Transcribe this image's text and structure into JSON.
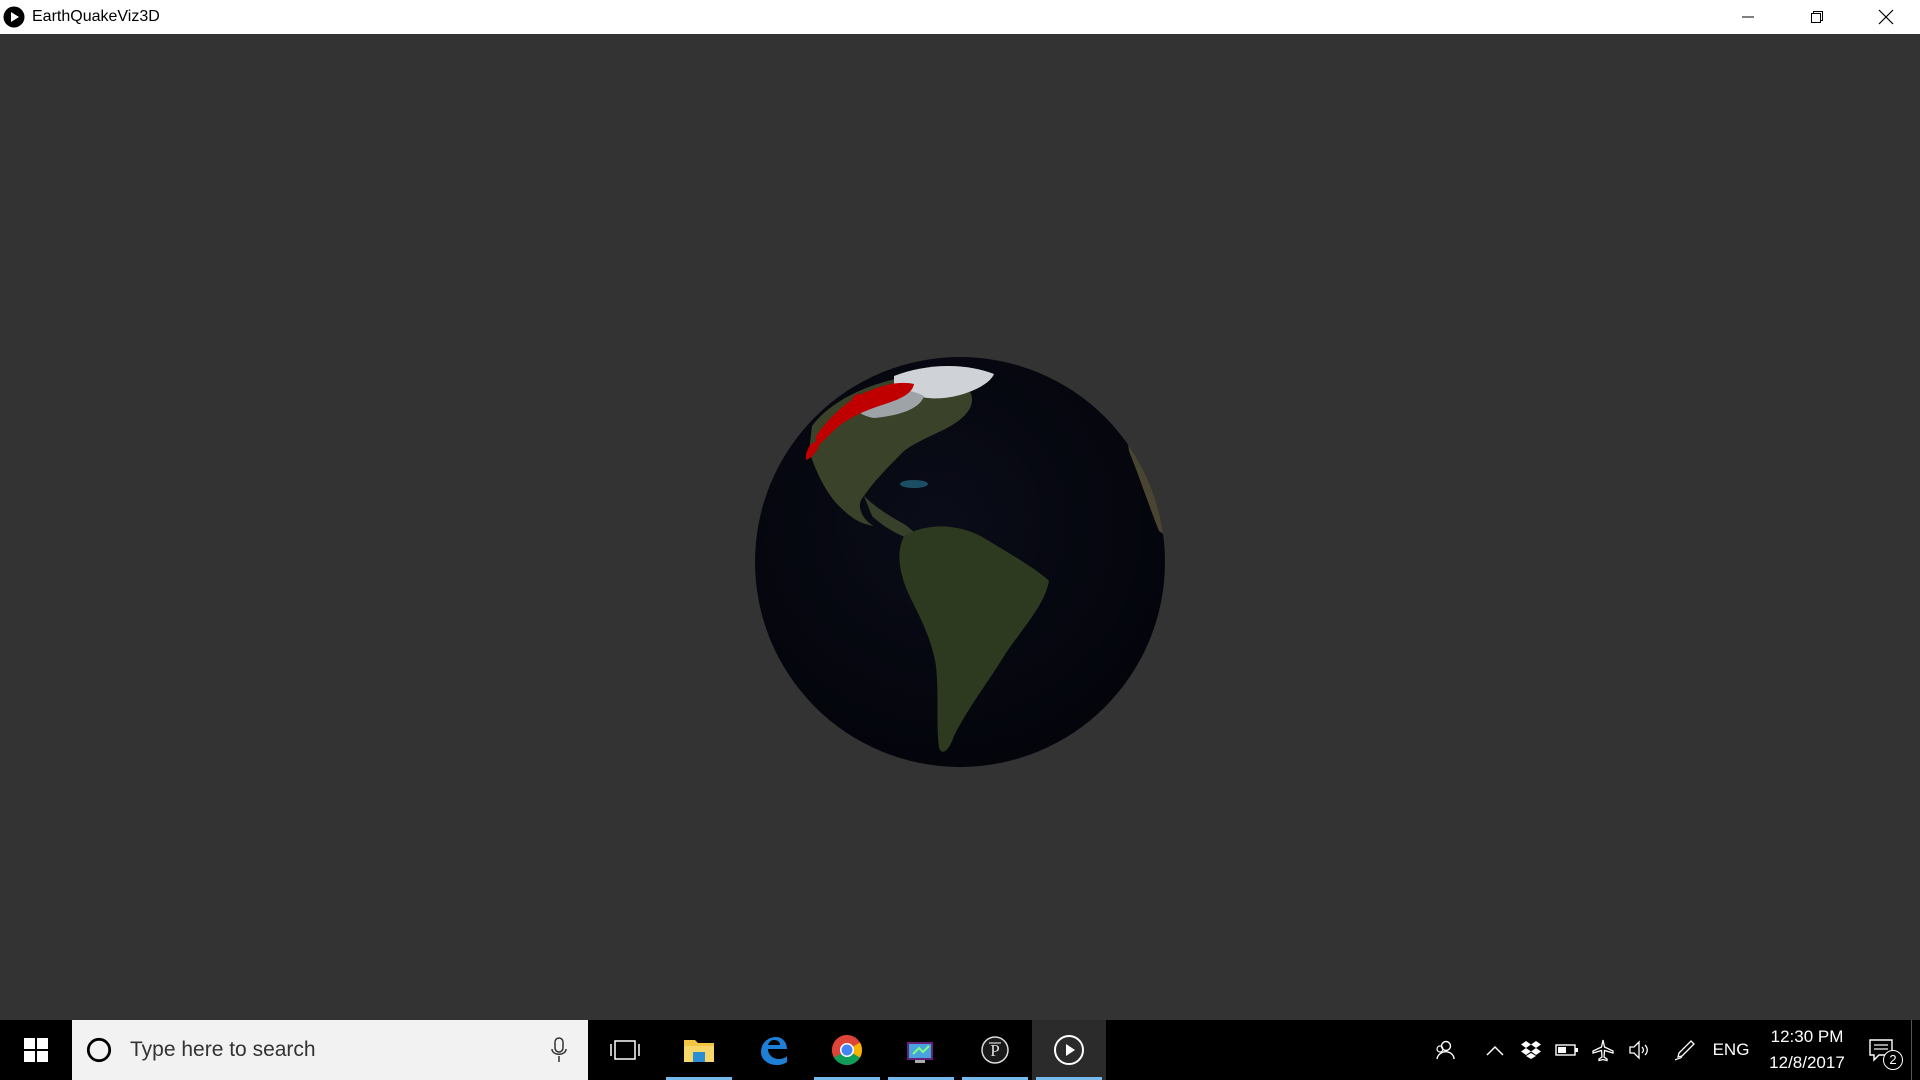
{
  "window": {
    "title": "EarthQuakeViz3D",
    "controls": [
      "minimize",
      "restore",
      "close"
    ]
  },
  "viewport": {
    "background_color": "#333333",
    "globe": {
      "ocean_color": "#05060f",
      "land_color": "#2f3a22",
      "quake_marker_color": "#c00000",
      "snow_color": "#cfd3d8"
    }
  },
  "taskbar": {
    "search_placeholder": "Type here to search",
    "apps": [
      {
        "name": "task-view",
        "running": false
      },
      {
        "name": "file-explorer",
        "running": true
      },
      {
        "name": "edge",
        "running": false
      },
      {
        "name": "chrome",
        "running": true
      },
      {
        "name": "visual-studio-installer",
        "running": true
      },
      {
        "name": "processing",
        "running": true
      },
      {
        "name": "earthquakeviz3d",
        "running": true,
        "active": true
      }
    ],
    "tray": {
      "language": "ENG",
      "time": "12:30 PM",
      "date": "12/8/2017",
      "notification_count": "2"
    }
  },
  "colors": {
    "taskbar_bg": "#000000",
    "search_bg": "#f2f2f2",
    "running_indicator": "#76b9ed",
    "edge_blue": "#1e7fd6"
  }
}
